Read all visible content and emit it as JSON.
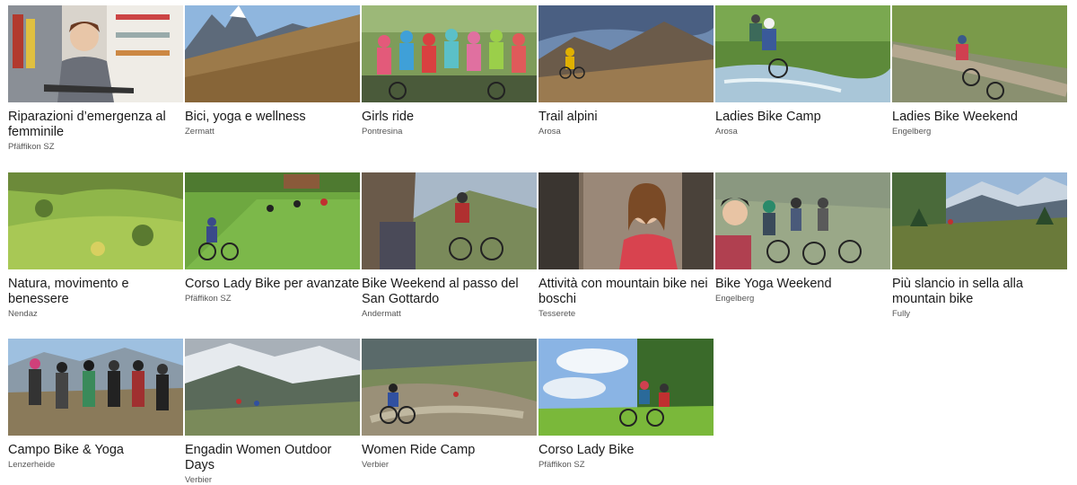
{
  "cards": [
    {
      "title": "Riparazioni d’emergenza al femminile",
      "location": "Pfäffikon SZ"
    },
    {
      "title": "Bici, yoga e wellness",
      "location": "Zermatt"
    },
    {
      "title": "Girls ride",
      "location": "Pontresina"
    },
    {
      "title": "Trail alpini",
      "location": "Arosa"
    },
    {
      "title": "Ladies Bike Camp",
      "location": "Arosa"
    },
    {
      "title": "Ladies Bike Weekend",
      "location": "Engelberg"
    },
    {
      "title": "Natura, movimento e benessere",
      "location": "Nendaz"
    },
    {
      "title": "Corso Lady Bike per avanzate",
      "location": "Pfäffikon SZ"
    },
    {
      "title": "Bike Weekend al passo del San Gottardo",
      "location": "Andermatt"
    },
    {
      "title": "Attività con mountain bike nei boschi",
      "location": "Tesserete"
    },
    {
      "title": "Bike Yoga Weekend",
      "location": "Engelberg"
    },
    {
      "title": "Più slancio in sella alla mountain bike",
      "location": "Fully"
    },
    {
      "title": "Campo Bike & Yoga",
      "location": "Lenzerheide"
    },
    {
      "title": "Engadin Women Outdoor Days",
      "location": "Verbier"
    },
    {
      "title": "Women Ride Camp",
      "location": "Verbier"
    },
    {
      "title": "Corso Lady Bike",
      "location": "Pfäffikon SZ"
    }
  ]
}
